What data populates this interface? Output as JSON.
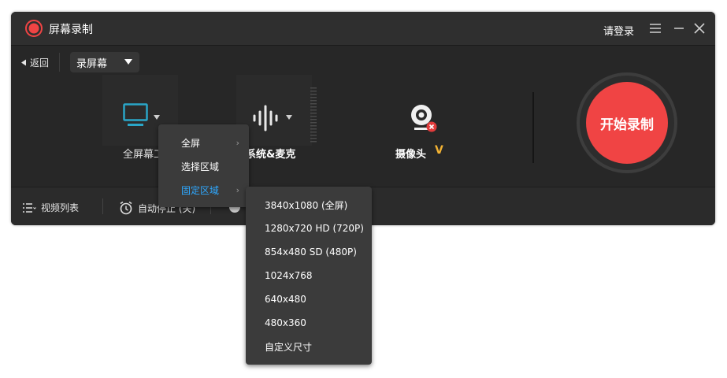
{
  "app": {
    "title": "屏幕录制",
    "login": "请登录"
  },
  "toolbar": {
    "back_label": "返回",
    "mode": "录屏幕"
  },
  "panels": {
    "screen_label": "全屏幕工",
    "audio_label": "系统&麦克",
    "camera_label": "摄像头",
    "camera_badge": "V"
  },
  "record": {
    "label": "开始录制"
  },
  "bottom": {
    "video_list": "视频列表",
    "auto_stop": "自动停止 (关)"
  },
  "menu_main": {
    "items": [
      {
        "label": "全屏",
        "has_sub": true
      },
      {
        "label": "选择区域",
        "has_sub": false
      },
      {
        "label": "固定区域",
        "has_sub": true
      }
    ]
  },
  "menu_sizes": {
    "items": [
      "3840x1080 (全屏)",
      "1280x720 HD (720P)",
      "854x480 SD (480P)",
      "1024x768",
      "640x480",
      "480x360",
      "自定义尺寸"
    ]
  },
  "colors": {
    "accent": "#2ea8ff",
    "record": "#f04444",
    "screen_icon": "#2aa6c8",
    "badge": "#f2b233"
  }
}
